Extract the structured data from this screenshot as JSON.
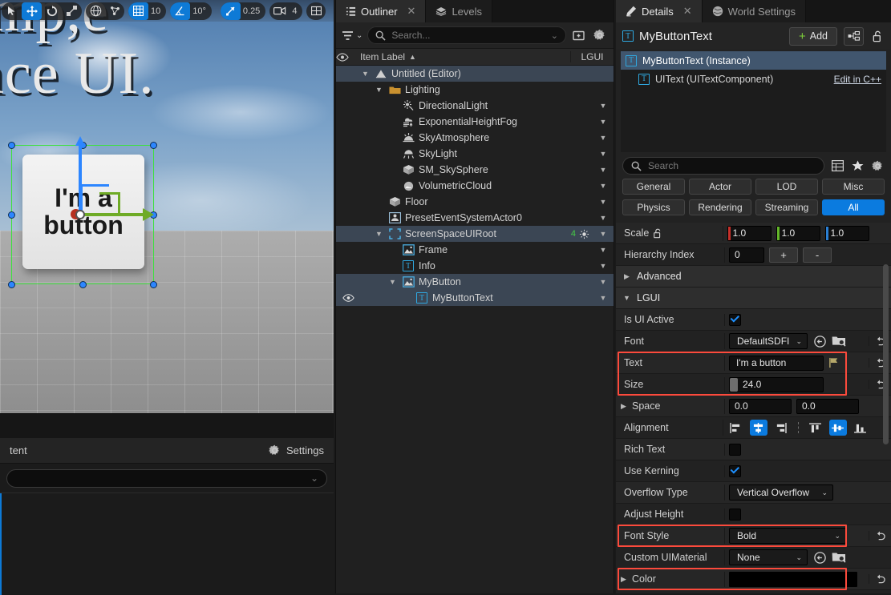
{
  "viewport": {
    "scene_text_line1": "mp,e",
    "scene_text_line2": "ace UI.",
    "button_label": "I'm a button",
    "toolbar": {
      "grid_snap_value": "10",
      "angle_snap_value": "10°",
      "scale_snap_value": "0.25",
      "camera_speed_value": "4",
      "icons": [
        "select-icon",
        "move-icon",
        "rotate-icon",
        "scale-icon",
        "world-icon",
        "snap-actor-icon",
        "grid-snap-icon",
        "angle-snap-icon",
        "scale-snap-icon",
        "camera-speed-icon",
        "layout-icon"
      ]
    }
  },
  "content_browser": {
    "title": "tent",
    "settings_label": "Settings",
    "search_placeholder": ""
  },
  "outliner": {
    "tabs": [
      {
        "label": "Outliner",
        "icon": "outliner-icon",
        "active": true,
        "closable": true
      },
      {
        "label": "Levels",
        "icon": "levels-icon",
        "active": false,
        "closable": false
      }
    ],
    "search_placeholder": "Search...",
    "columns": {
      "item_label": "Item Label",
      "sort": "▲",
      "lgui": "LGUI"
    },
    "rows": [
      {
        "label": "Untitled (Editor)",
        "indent": 1,
        "caret": "down",
        "icon": "level-icon",
        "selected": true,
        "chevron": false,
        "eye": false
      },
      {
        "label": "Lighting",
        "indent": 2,
        "caret": "down",
        "icon": "folder-icon",
        "selected": false,
        "chevron": false,
        "eye": false
      },
      {
        "label": "DirectionalLight",
        "indent": 3,
        "caret": "none",
        "icon": "directional-light-icon",
        "selected": false,
        "chevron": true,
        "eye": false
      },
      {
        "label": "ExponentialHeightFog",
        "indent": 3,
        "caret": "none",
        "icon": "fog-icon",
        "selected": false,
        "chevron": true,
        "eye": false
      },
      {
        "label": "SkyAtmosphere",
        "indent": 3,
        "caret": "none",
        "icon": "sky-atmosphere-icon",
        "selected": false,
        "chevron": true,
        "eye": false
      },
      {
        "label": "SkyLight",
        "indent": 3,
        "caret": "none",
        "icon": "sky-light-icon",
        "selected": false,
        "chevron": true,
        "eye": false
      },
      {
        "label": "SM_SkySphere",
        "indent": 3,
        "caret": "none",
        "icon": "static-mesh-icon",
        "selected": false,
        "chevron": true,
        "eye": false
      },
      {
        "label": "VolumetricCloud",
        "indent": 3,
        "caret": "none",
        "icon": "cloud-icon",
        "selected": false,
        "chevron": true,
        "eye": false
      },
      {
        "label": "Floor",
        "indent": 2,
        "caret": "none",
        "icon": "static-mesh-icon",
        "selected": false,
        "chevron": true,
        "eye": false
      },
      {
        "label": "PresetEventSystemActor0",
        "indent": 2,
        "caret": "none",
        "icon": "actor-icon",
        "selected": false,
        "chevron": true,
        "eye": false
      },
      {
        "label": "ScreenSpaceUIRoot",
        "indent": 2,
        "caret": "down",
        "icon": "uiroot-icon",
        "selected": true,
        "chevron": true,
        "badge": "4",
        "eye": false
      },
      {
        "label": "Frame",
        "indent": 3,
        "caret": "none",
        "icon": "uisprite-icon",
        "selected": false,
        "chevron": true,
        "eye": false
      },
      {
        "label": "Info",
        "indent": 3,
        "caret": "none",
        "icon": "uitext-icon",
        "selected": false,
        "chevron": true,
        "eye": false
      },
      {
        "label": "MyButton",
        "indent": 3,
        "caret": "down",
        "icon": "uisprite-icon",
        "selected": true,
        "chevron": true,
        "eye": false
      },
      {
        "label": "MyButtonText",
        "indent": 4,
        "caret": "none",
        "icon": "uitext-icon",
        "selected": true,
        "chevron": true,
        "eye": true
      }
    ]
  },
  "details": {
    "tabs": [
      {
        "label": "Details",
        "icon": "details-icon",
        "active": true,
        "closable": true
      },
      {
        "label": "World Settings",
        "icon": "globe-icon",
        "active": false,
        "closable": false
      }
    ],
    "object_title": "MyButtonText",
    "add_label": "Add",
    "components": [
      {
        "label": "MyButtonText (Instance)",
        "selected": true,
        "indent": 0,
        "action": ""
      },
      {
        "label": "UIText (UITextComponent)",
        "selected": false,
        "indent": 1,
        "action": "Edit in C++"
      }
    ],
    "search_placeholder": "Search",
    "categories_row1": [
      {
        "label": "General",
        "active": false
      },
      {
        "label": "Actor",
        "active": false
      },
      {
        "label": "LOD",
        "active": false
      },
      {
        "label": "Misc",
        "active": false
      }
    ],
    "categories_row2": [
      {
        "label": "Physics",
        "active": false
      },
      {
        "label": "Rendering",
        "active": false
      },
      {
        "label": "Streaming",
        "active": false
      },
      {
        "label": "All",
        "active": true
      }
    ],
    "properties": [
      {
        "type": "vector",
        "name": "Scale",
        "lock": true,
        "values": [
          "1.0",
          "1.0",
          "1.0"
        ],
        "reset": false
      },
      {
        "type": "stepper",
        "name": "Hierarchy Index",
        "value": "0",
        "plus": "+",
        "minus": "-",
        "reset": false
      },
      {
        "type": "header",
        "name": "Advanced",
        "expanded": false
      },
      {
        "type": "category",
        "name": "LGUI",
        "expanded": true
      },
      {
        "type": "checkbox",
        "name": "Is UI Active",
        "checked": true,
        "reset": false
      },
      {
        "type": "asset",
        "name": "Font",
        "value": "DefaultSDFI",
        "reset": true
      },
      {
        "type": "text",
        "name": "Text",
        "value": "I'm a button",
        "flag": true,
        "reset": true,
        "highlight": true
      },
      {
        "type": "number",
        "name": "Size",
        "value": "24.0",
        "reset": true,
        "highlight": true
      },
      {
        "type": "vector2",
        "name": "Space",
        "expandable": true,
        "values": [
          "0.0",
          "0.0"
        ],
        "reset": false
      },
      {
        "type": "alignment",
        "name": "Alignment",
        "h_selected": 1,
        "v_selected": 1,
        "reset": false
      },
      {
        "type": "checkbox",
        "name": "Rich Text",
        "checked": false,
        "reset": false
      },
      {
        "type": "checkbox",
        "name": "Use Kerning",
        "checked": true,
        "reset": false
      },
      {
        "type": "dropdown",
        "name": "Overflow Type",
        "value": "Vertical Overflow",
        "reset": false
      },
      {
        "type": "checkbox",
        "name": "Adjust Height",
        "checked": false,
        "reset": false
      },
      {
        "type": "dropdown",
        "name": "Font Style",
        "value": "Bold",
        "reset": true,
        "highlight": true
      },
      {
        "type": "asset",
        "name": "Custom UIMaterial",
        "value": "None",
        "reset": false
      },
      {
        "type": "color",
        "name": "Color",
        "expandable": true,
        "value": "#000000",
        "reset": true,
        "highlight": true
      }
    ]
  },
  "colors": {
    "accent_blue": "#0b7bdf",
    "highlight_red": "#fc4a3c",
    "selection_row": "#3b4654",
    "panel_bg": "#222222",
    "green_badge": "#46c946"
  }
}
